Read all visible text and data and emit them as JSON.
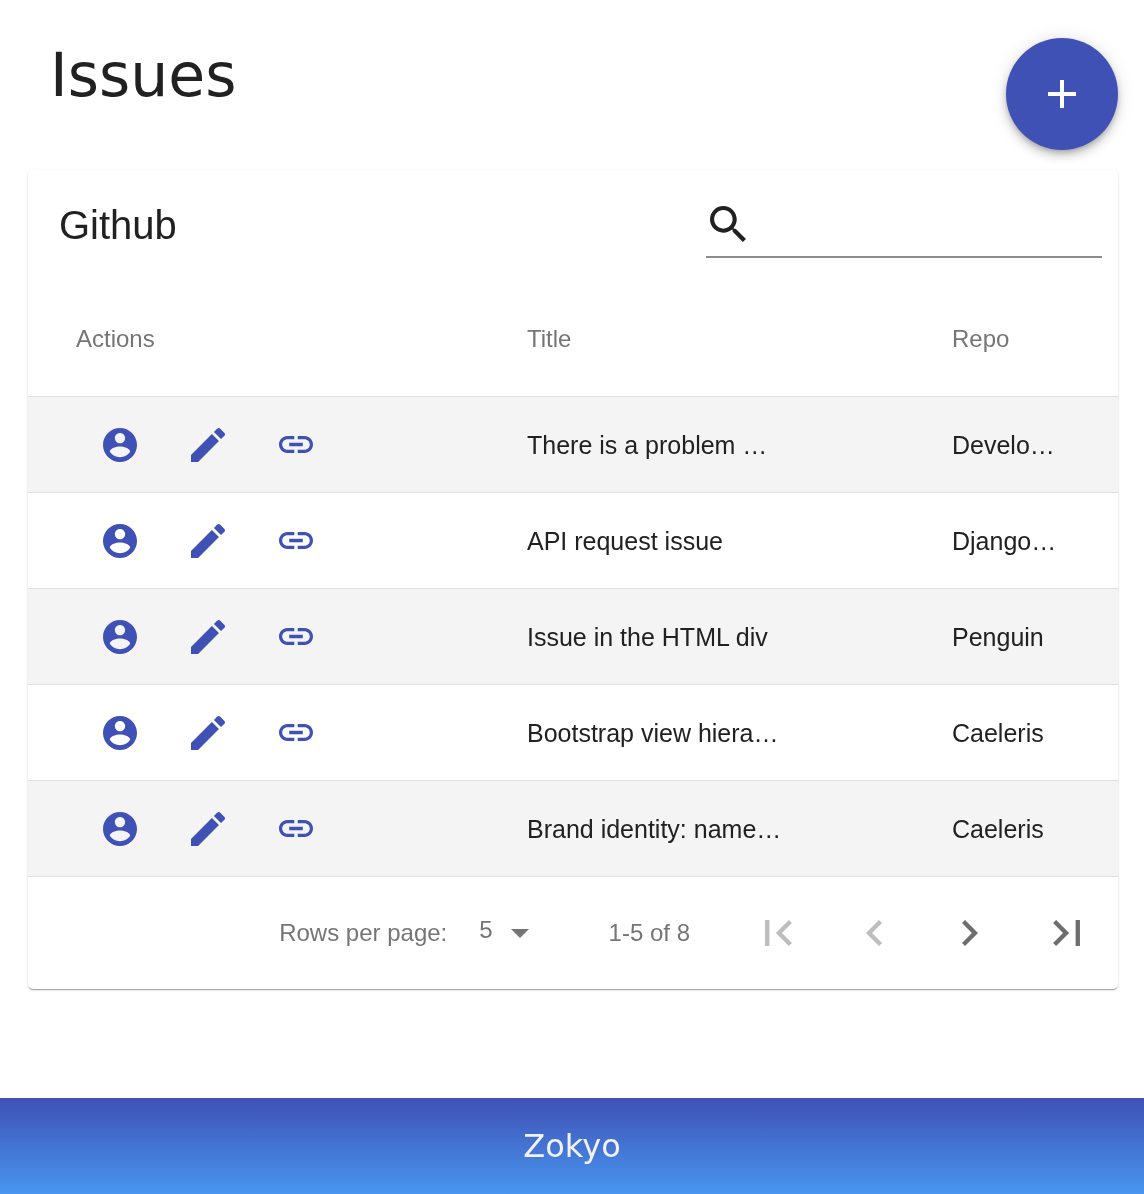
{
  "page": {
    "title": "Issues"
  },
  "card": {
    "title": "Github"
  },
  "table": {
    "columns": [
      "Actions",
      "Title",
      "Repo"
    ],
    "rows": [
      {
        "title": "There is a problem …",
        "repo": "Develo…"
      },
      {
        "title": "API request issue",
        "repo": "Django…"
      },
      {
        "title": "Issue in the HTML div",
        "repo": "Penguin"
      },
      {
        "title": "Bootstrap view hiera…",
        "repo": "Caeleris"
      },
      {
        "title": "Brand identity: name…",
        "repo": "Caeleris"
      }
    ]
  },
  "pagination": {
    "rows_per_page_label": "Rows per page:",
    "rows_per_page": "5",
    "range": "1-5 of 8",
    "buttons": [
      {
        "kind": "first",
        "disabled": true
      },
      {
        "kind": "previous",
        "disabled": true
      },
      {
        "kind": "next",
        "disabled": false
      },
      {
        "kind": "last",
        "disabled": false
      }
    ]
  },
  "footer": {
    "brand": "Zokyo"
  }
}
